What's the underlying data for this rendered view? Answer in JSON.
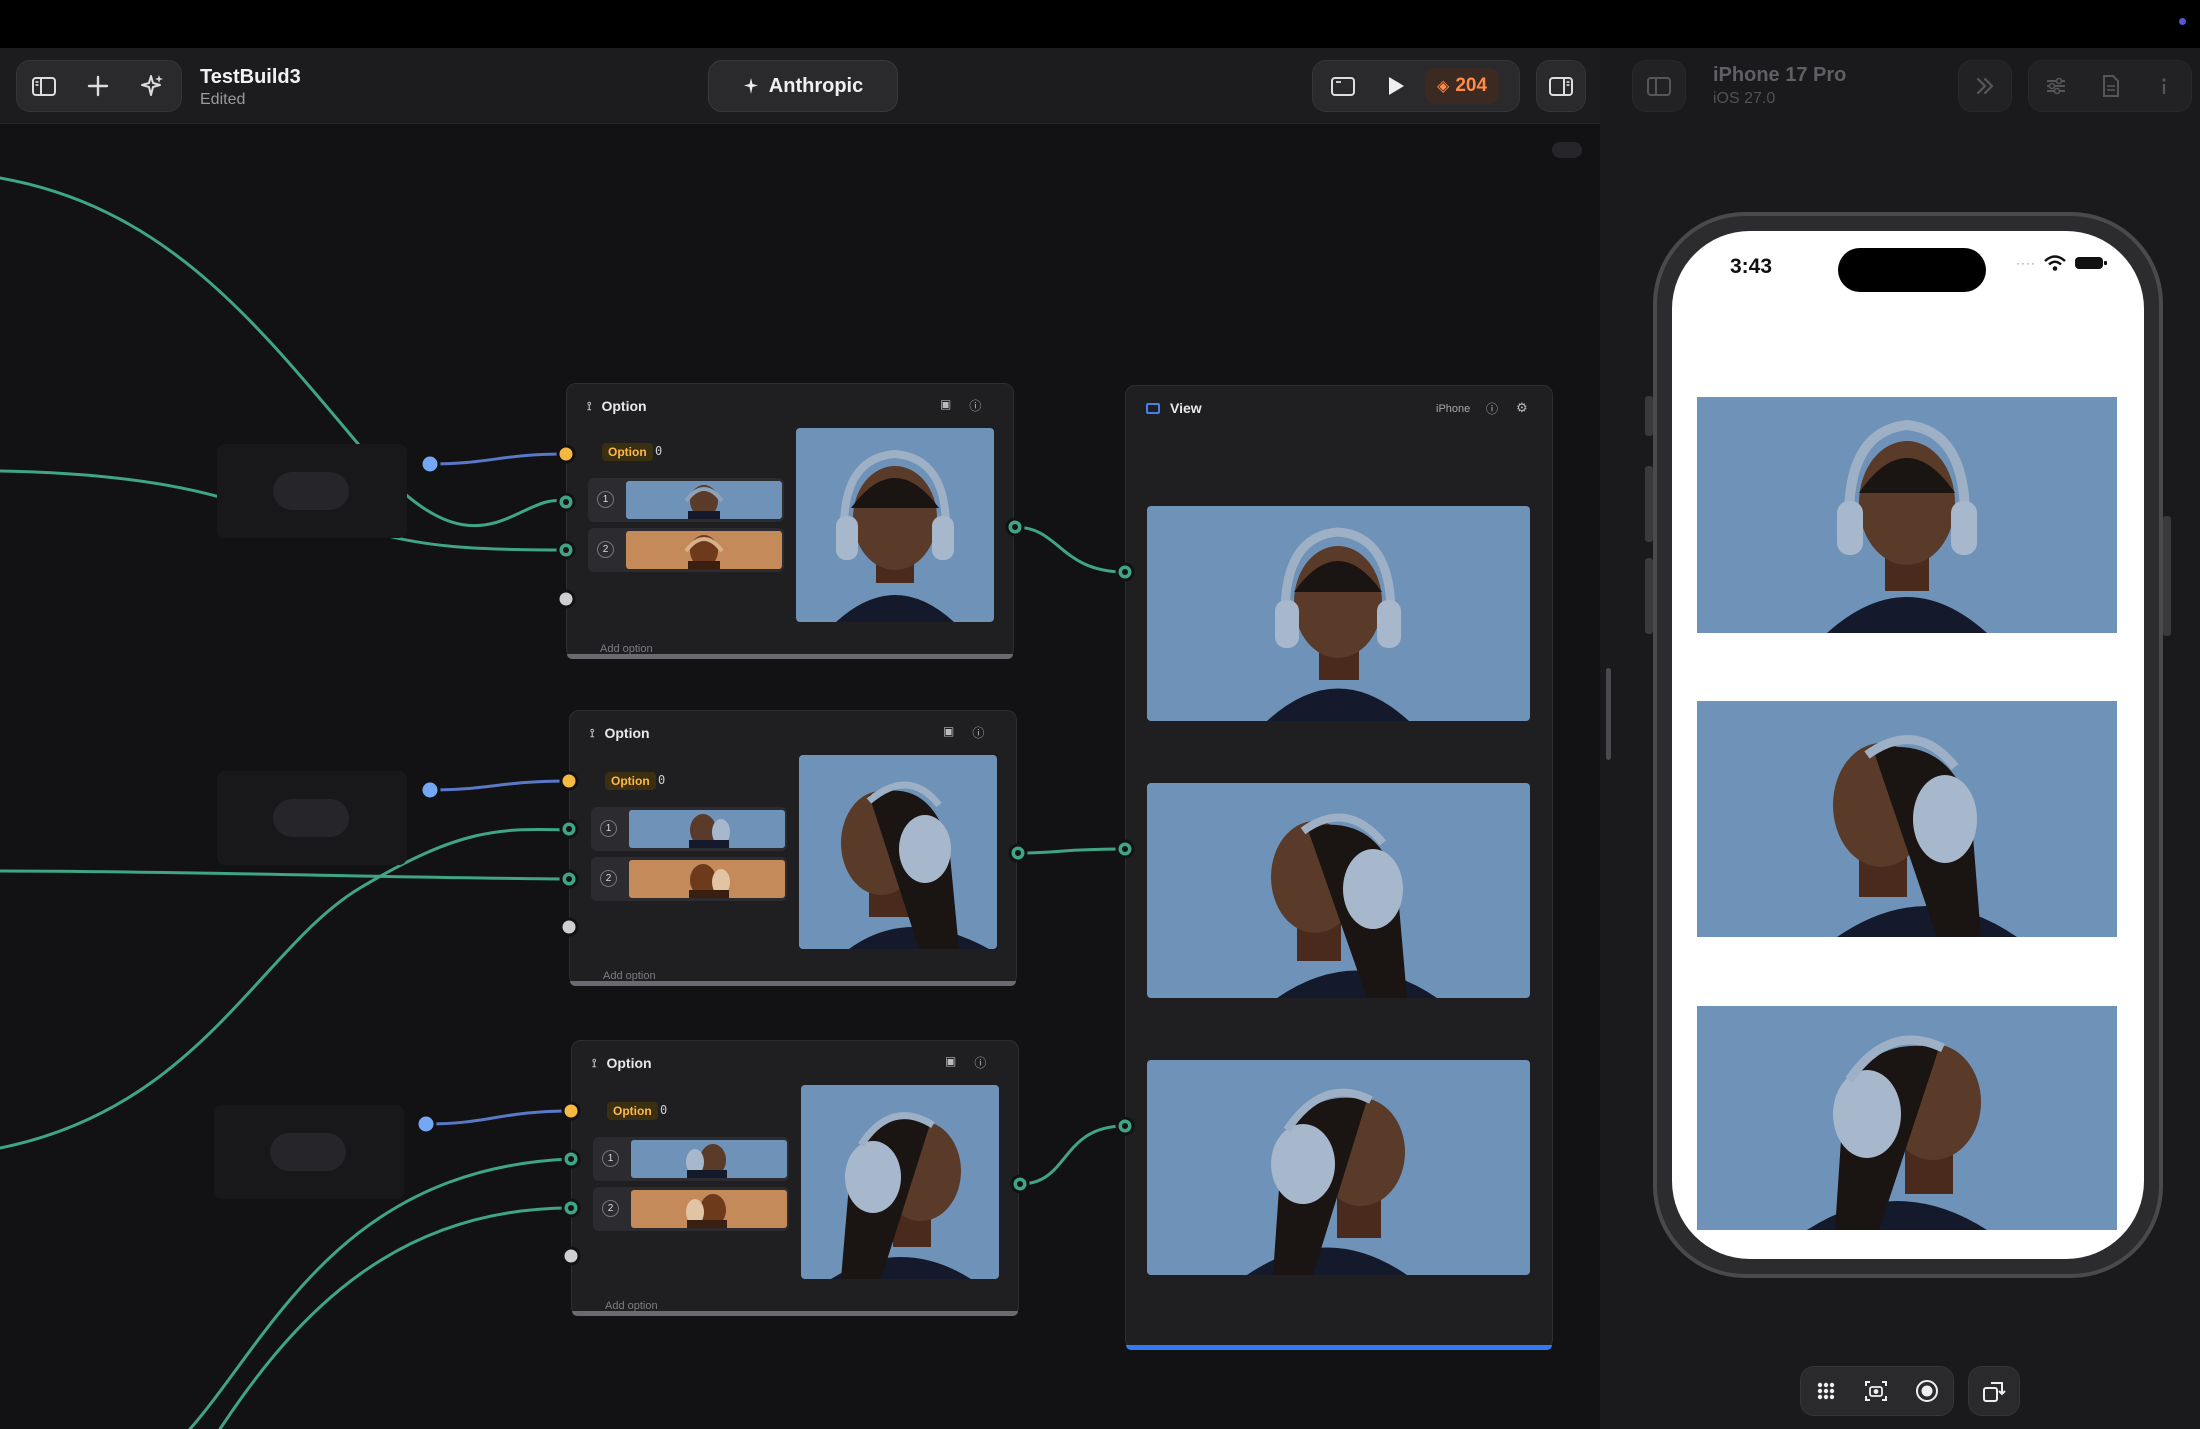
{
  "toolbar": {
    "title": "TestBuild3",
    "subtitle": "Edited",
    "model_label": "Anthropic",
    "credits": "204"
  },
  "preview": {
    "device_name": "iPhone 17 Pro",
    "os_version": "iOS 27.0",
    "clock": "3:43"
  },
  "nodes": {
    "option_title": "Option",
    "option_badge": "Option",
    "option_index": "0",
    "row1": "1",
    "row2": "2",
    "add_option": "Add option",
    "view_title": "View",
    "view_device": "iPhone"
  },
  "colors": {
    "wire_green": "#3fa583",
    "wire_blue": "#5a78c8",
    "port_blue": "#74a8f5",
    "port_orange": "#f5b942",
    "credits_orange": "#ff8a4a",
    "photo_background": "#6f93b8",
    "selection_blue": "#2f7cf6"
  }
}
